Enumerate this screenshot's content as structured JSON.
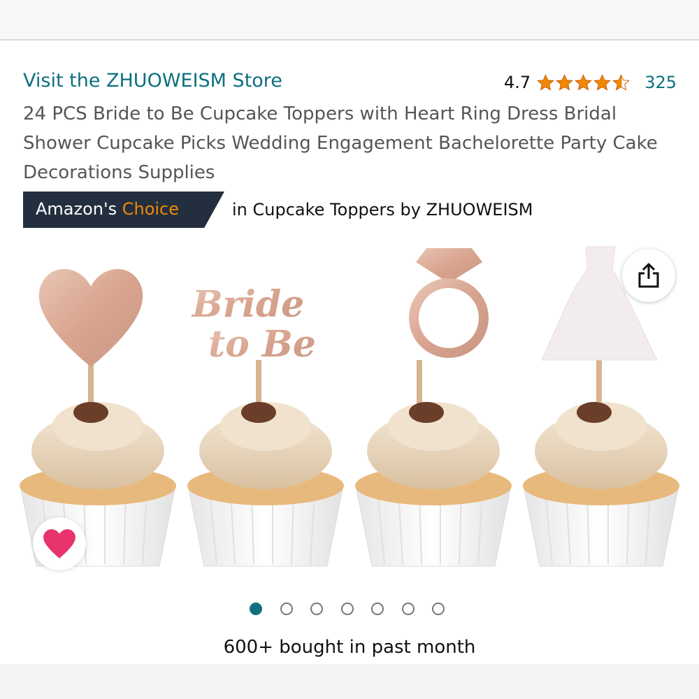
{
  "store": {
    "link_text": "Visit the ZHUOWEISM Store"
  },
  "rating": {
    "value": "4.7",
    "stars": 4.7,
    "count": "325",
    "star_color": "#f08804"
  },
  "product": {
    "title": "24 PCS Bride to Be Cupcake Toppers with Heart Ring Dress Bridal Shower Cupcake Picks Wedding Engagement Bachelorette Party Cake Decorations Supplies",
    "image_alt": "Cupcakes topped with heart, Bride to Be, ring and dress picks"
  },
  "badge": {
    "prefix": "Amazon's ",
    "highlight": "Choice",
    "suffix": "in Cupcake Toppers by ZHUOWEISM",
    "bg_color": "#232f3e",
    "highlight_color": "#f08804"
  },
  "carousel": {
    "total": 7,
    "active": 1
  },
  "icons": {
    "share": "share-icon",
    "wishlist": "heart-icon",
    "wishlist_color": "#e8336d"
  },
  "sales": {
    "text": "600+ bought in past month"
  },
  "colors": {
    "link": "#0f6f80",
    "active_dot": "#11707f"
  }
}
